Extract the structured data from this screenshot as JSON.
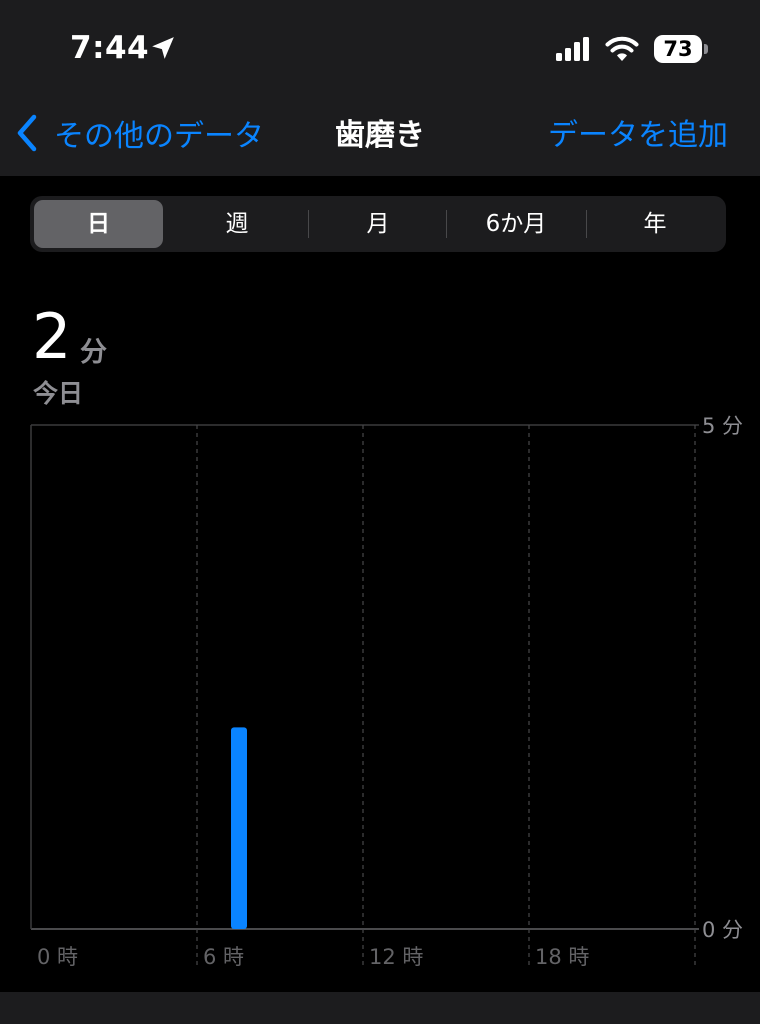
{
  "status_bar": {
    "time": "7:44",
    "battery": "73"
  },
  "nav": {
    "back_label": "その他のデータ",
    "title": "歯磨き",
    "add_label": "データを追加"
  },
  "segments": [
    {
      "label": "日",
      "selected": true
    },
    {
      "label": "週",
      "selected": false
    },
    {
      "label": "月",
      "selected": false
    },
    {
      "label": "6か月",
      "selected": false
    },
    {
      "label": "年",
      "selected": false
    }
  ],
  "summary": {
    "value": "2",
    "unit": "分",
    "date_label": "今日"
  },
  "colors": {
    "accent": "#0a84ff",
    "bar": "#0a84ff",
    "background": "#000000",
    "bar_background": "#1c1c1e",
    "secondary_text": "#8e8e93"
  },
  "chart_data": {
    "type": "bar",
    "x_ticks": [
      "0 時",
      "6 時",
      "12 時",
      "18 時"
    ],
    "x_range_hours": [
      0,
      24
    ],
    "y_ticks": [
      "5 分",
      "0 分"
    ],
    "ylim": [
      0,
      5
    ],
    "grid": true,
    "bars": [
      {
        "hour": 6,
        "value": 2
      }
    ]
  }
}
